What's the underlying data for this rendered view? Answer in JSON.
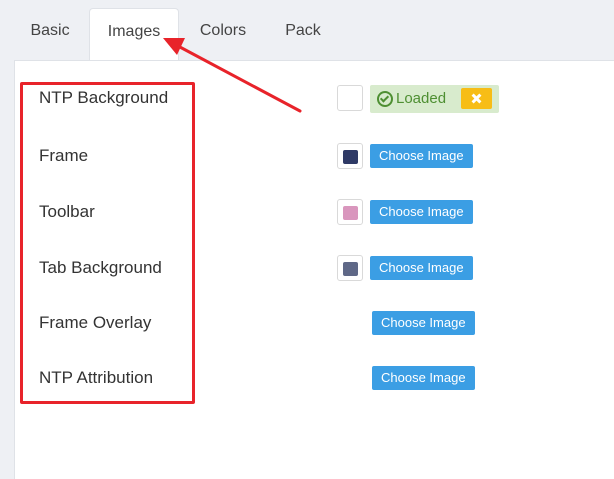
{
  "tabs": [
    {
      "label": "Basic",
      "active": false
    },
    {
      "label": "Images",
      "active": true
    },
    {
      "label": "Colors",
      "active": false
    },
    {
      "label": "Pack",
      "active": false
    }
  ],
  "rows": [
    {
      "label": "NTP Background",
      "status": "Loaded",
      "swatch_color": "#ffffff"
    },
    {
      "label": "Frame",
      "button": "Choose Image",
      "swatch_color": "#2f3a66"
    },
    {
      "label": "Toolbar",
      "button": "Choose Image",
      "swatch_color": "#d996bd"
    },
    {
      "label": "Tab Background",
      "button": "Choose Image",
      "swatch_color": "#5f6887"
    },
    {
      "label": "Frame Overlay",
      "button": "Choose Image"
    },
    {
      "label": "NTP Attribution",
      "button": "Choose Image"
    }
  ],
  "annotation": {
    "color": "#e8232a"
  },
  "icons": {
    "loaded": "check-circle-icon",
    "remove": "close-icon"
  }
}
